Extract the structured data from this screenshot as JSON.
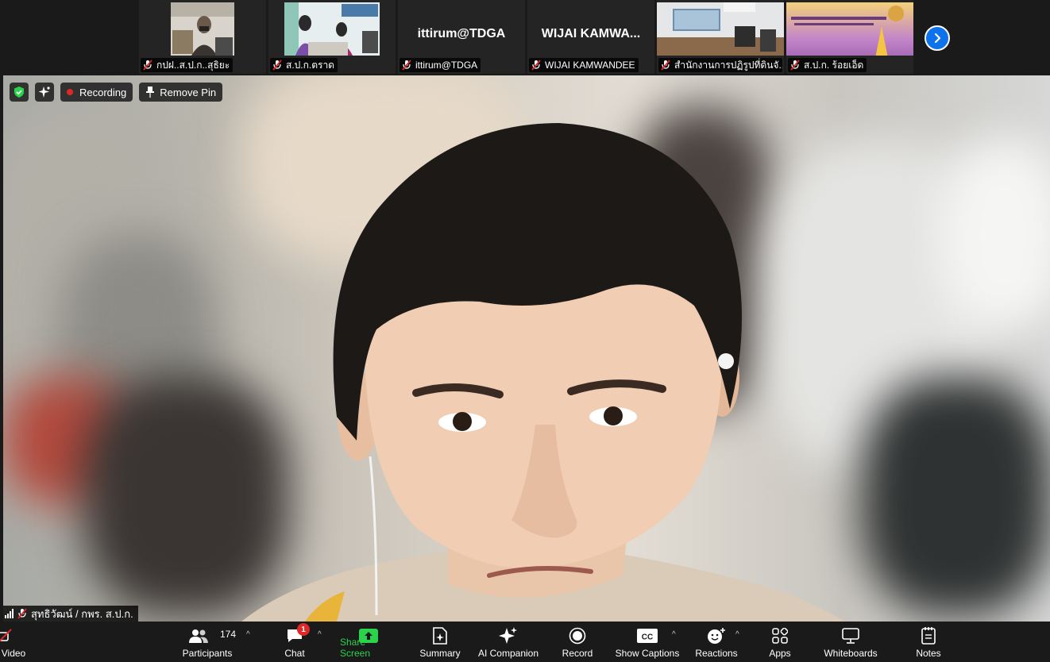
{
  "strip": {
    "tiles": [
      {
        "name": "กปฝ..ส.ป.ก..สุธิยะ",
        "kind": "video"
      },
      {
        "name": "ส.ป.ก.ตราด",
        "kind": "video"
      },
      {
        "name": "ittirum@TDGA",
        "display": "ittirum@TDGA",
        "kind": "name"
      },
      {
        "name": "WIJAI KAMWANDEE",
        "display": "WIJAI  KAMWA...",
        "kind": "name"
      },
      {
        "name": "สำนักงานการปฏิรูปที่ดินจั...",
        "kind": "video"
      },
      {
        "name": "ส.ป.ก. ร้อยเอ็ด",
        "kind": "video"
      }
    ],
    "next_icon": "chevron-right-icon"
  },
  "badges": {
    "security_icon": "shield-check-icon",
    "ai_icon": "sparkle-icon",
    "recording": "Recording",
    "remove_pin": "Remove Pin"
  },
  "main": {
    "speaker_name": "สุทธิวัฒน์ / กพร. ส.ป.ก."
  },
  "toolbar": {
    "video": "Video",
    "participants": "Participants",
    "participants_count": "174",
    "chat": "Chat",
    "chat_badge": "1",
    "share_screen": "Share Screen",
    "summary": "Summary",
    "ai_companion": "AI Companion",
    "record": "Record",
    "show_captions": "Show Captions",
    "reactions": "Reactions",
    "apps": "Apps",
    "whiteboards": "Whiteboards",
    "notes": "Notes",
    "caret": "^"
  },
  "colors": {
    "accent": "#0e72ed",
    "share_green": "#2bd34a",
    "recording_red": "#e02828",
    "bar_bg": "#1a1a1a"
  }
}
